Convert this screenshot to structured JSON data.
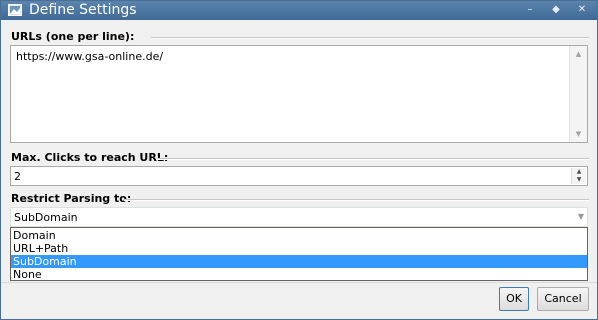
{
  "window": {
    "title": "Define Settings",
    "controls": {
      "minimize": "–",
      "maximize": "◆",
      "close": "✕"
    }
  },
  "urls": {
    "label": "URLs (one per line):",
    "value": "https://www.gsa-online.de/"
  },
  "max_clicks": {
    "label": "Max. Clicks to reach URL:",
    "value": "2"
  },
  "restrict": {
    "label": "Restrict Parsing to:",
    "selected": "SubDomain",
    "options": [
      "Domain",
      "URL+Path",
      "SubDomain",
      "None"
    ]
  },
  "buttons": {
    "ok": "OK",
    "cancel": "Cancel"
  },
  "colors": {
    "titlebar": "#4a77a3",
    "selection": "#3399ff",
    "background": "#f0f0f0"
  }
}
